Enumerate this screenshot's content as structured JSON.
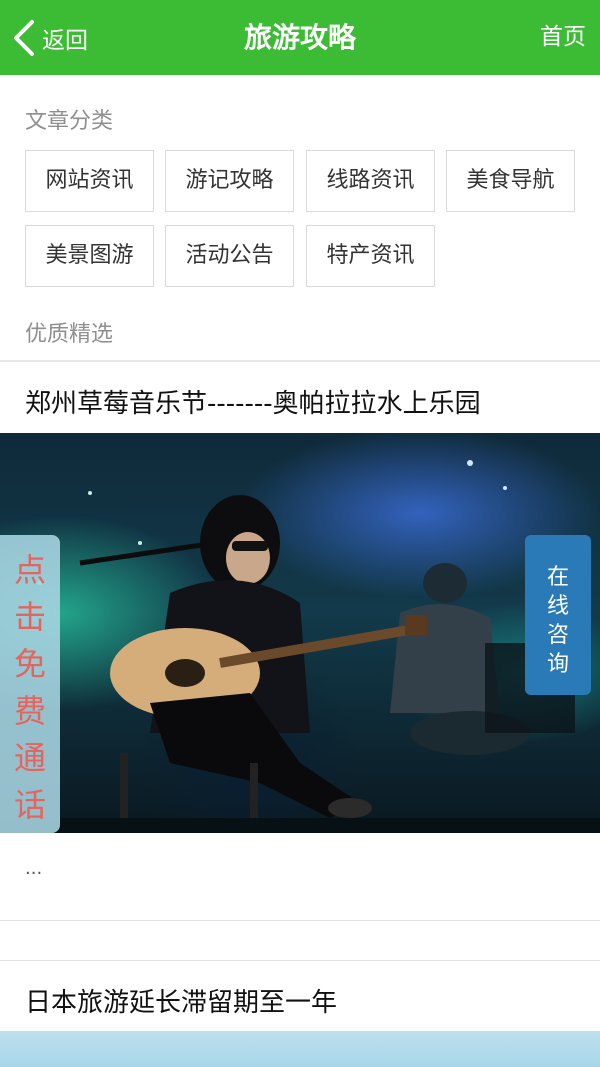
{
  "header": {
    "back_label": "返回",
    "title": "旅游攻略",
    "home_label": "首页",
    "bg_color": "#3cbb34"
  },
  "categories": {
    "heading": "文章分类",
    "items": [
      "网站资讯",
      "游记攻略",
      "线路资讯",
      "美食导航",
      "美景图游",
      "活动公告",
      "特产资讯"
    ]
  },
  "featured": {
    "heading": "优质精选",
    "articles": [
      {
        "title": "郑州草莓音乐节-------奥帕拉拉水上乐园",
        "excerpt": "..."
      },
      {
        "title": "日本旅游延长滞留期至一年"
      }
    ]
  },
  "float_buttons": {
    "free_call": [
      "点",
      "击",
      "免",
      "费",
      "通",
      "话"
    ],
    "online_consult": [
      "在",
      "线",
      "咨",
      "询"
    ]
  }
}
